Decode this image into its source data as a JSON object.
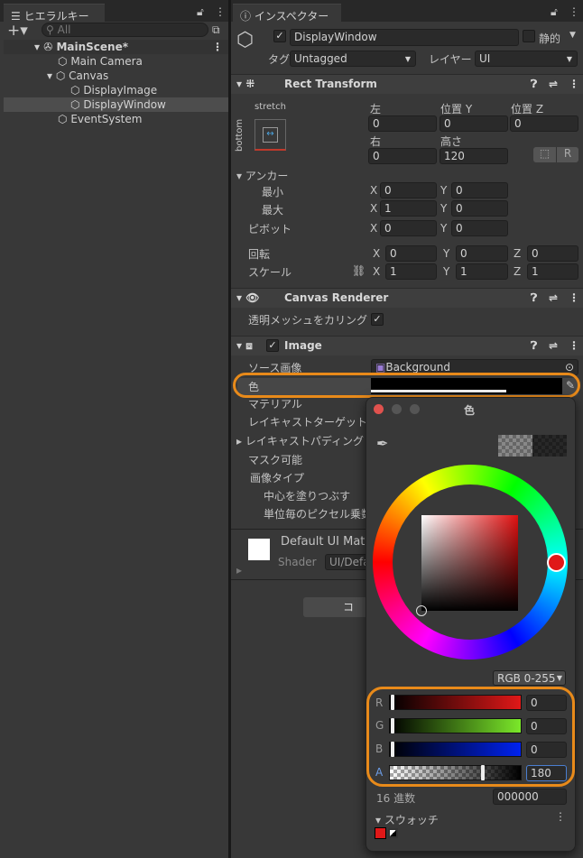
{
  "hierarchy": {
    "tab": "ヒエラルキー",
    "search_placeholder": "All",
    "items": [
      {
        "label": "MainScene*",
        "bold": true
      },
      {
        "label": "Main Camera"
      },
      {
        "label": "Canvas"
      },
      {
        "label": "DisplayImage"
      },
      {
        "label": "DisplayWindow",
        "selected": true
      },
      {
        "label": "EventSystem"
      }
    ]
  },
  "inspector": {
    "tab": "インスペクター",
    "object_name": "DisplayWindow",
    "static_label": "静的",
    "tag_label": "タグ",
    "tag_value": "Untagged",
    "layer_label": "レイヤー",
    "layer_value": "UI",
    "rect_transform": {
      "title": "Rect Transform",
      "anchor_preset_top": "stretch",
      "anchor_preset_side": "bottom",
      "left_label": "左",
      "left": "0",
      "posy_label": "位置 Y",
      "posy": "0",
      "posz_label": "位置 Z",
      "posz": "0",
      "right_label": "右",
      "right": "0",
      "height_label": "高さ",
      "height": "120",
      "r_button": "R",
      "anchors_label": "アンカー",
      "min_label": "最小",
      "min_x": "0",
      "min_y": "0",
      "max_label": "最大",
      "max_x": "1",
      "max_y": "0",
      "pivot_label": "ピボット",
      "pivot_x": "0",
      "pivot_y": "0",
      "rotation_label": "回転",
      "rot_x": "0",
      "rot_y": "0",
      "rot_z": "0",
      "scale_label": "スケール",
      "scale_x": "1",
      "scale_y": "1",
      "scale_z": "1"
    },
    "canvas_renderer": {
      "title": "Canvas Renderer",
      "cull_label": "透明メッシュをカリング"
    },
    "image": {
      "title": "Image",
      "source_label": "ソース画像",
      "source_value": "Background",
      "color_label": "色",
      "material_label": "マテリアル",
      "raycast_target_label": "レイキャストターゲット",
      "raycast_padding_label": "レイキャストパディング",
      "maskable_label": "マスク可能",
      "image_type_label": "画像タイプ",
      "fill_center_label": "中心を塗りつぶす",
      "ppu_label": "単位毎のピクセル乗数"
    },
    "material": {
      "name": "Default UI Mate",
      "shader_label": "Shader",
      "shader_value": "UI/Defa"
    },
    "add_component": "コ"
  },
  "color_picker": {
    "title": "色",
    "mode": "RGB 0-255",
    "r_label": "R",
    "r": "0",
    "g_label": "G",
    "g": "0",
    "b_label": "B",
    "b": "0",
    "a_label": "A",
    "a": "180",
    "alpha_fraction": 0.706,
    "hex_label": "16 進数",
    "hex": "000000",
    "swatches_label": "スウォッチ",
    "swatch_color": "#e01818",
    "current_color": "#000000"
  },
  "colors": {
    "highlight": "#e88a1a",
    "panel": "#383838"
  }
}
